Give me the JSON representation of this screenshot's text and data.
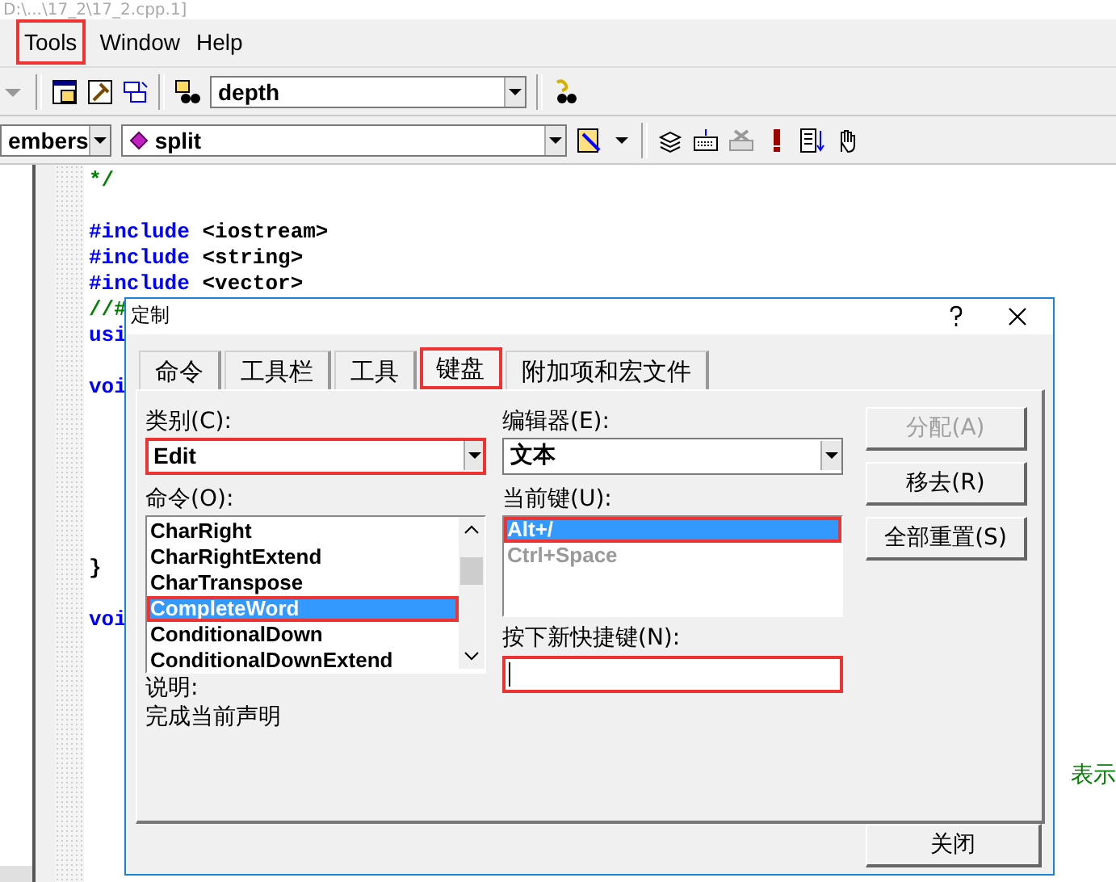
{
  "window": {
    "title": "D:\\...\\17_2\\17_2.cpp.1]"
  },
  "menu": [
    {
      "label": "Tools",
      "highlighted": true
    },
    {
      "label": "Window",
      "highlighted": false
    },
    {
      "label": "Help",
      "highlighted": false
    }
  ],
  "toolbar_1": {
    "find_combo": {
      "value": "depth"
    }
  },
  "toolbar_2": {
    "class_combo": {
      "value": "embers"
    },
    "member_combo": {
      "value": "split"
    }
  },
  "code_lines": [
    {
      "kind": "comment",
      "text": "*/"
    },
    {
      "kind": "blank"
    },
    {
      "kind": "directive",
      "keyword": "#include",
      "text": "<iostream>"
    },
    {
      "kind": "directive",
      "keyword": "#include",
      "text": "<string>"
    },
    {
      "kind": "directive",
      "keyword": "#include",
      "text": "<vector>"
    },
    {
      "kind": "comment",
      "text": "//#"
    },
    {
      "kind": "keyword",
      "text": "usi"
    },
    {
      "kind": "blank"
    },
    {
      "kind": "keyword",
      "text": "voi"
    },
    {
      "kind": "blank"
    },
    {
      "kind": "blank"
    },
    {
      "kind": "blank"
    },
    {
      "kind": "blank"
    },
    {
      "kind": "blank"
    },
    {
      "kind": "blank"
    },
    {
      "kind": "plain",
      "text": "}"
    },
    {
      "kind": "blank"
    },
    {
      "kind": "keyword",
      "text": "voi"
    },
    {
      "kind": "blank"
    },
    {
      "kind": "blank"
    },
    {
      "kind": "blank"
    },
    {
      "kind": "blank"
    },
    {
      "kind": "blank"
    },
    {
      "kind": "comment_tail",
      "text": "表示"
    }
  ],
  "dialog": {
    "title": "定制",
    "tabs": [
      {
        "label": "命令",
        "selected": false,
        "highlighted": false
      },
      {
        "label": "工具栏",
        "selected": false,
        "highlighted": false
      },
      {
        "label": "工具",
        "selected": false,
        "highlighted": false
      },
      {
        "label": "键盘",
        "selected": true,
        "highlighted": true
      },
      {
        "label": "附加项和宏文件",
        "selected": false,
        "highlighted": false
      }
    ],
    "category": {
      "label": "类别(C):",
      "value": "Edit",
      "highlighted": true
    },
    "editor": {
      "label": "编辑器(E):",
      "value": "文本"
    },
    "commands": {
      "label": "命令(O):",
      "items": [
        {
          "label": "CharRight",
          "selected": false,
          "highlighted": false
        },
        {
          "label": "CharRightExtend",
          "selected": false,
          "highlighted": false
        },
        {
          "label": "CharTranspose",
          "selected": false,
          "highlighted": false
        },
        {
          "label": "CompleteWord",
          "selected": true,
          "highlighted": true
        },
        {
          "label": "ConditionalDown",
          "selected": false,
          "highlighted": false
        },
        {
          "label": "ConditionalDownExtend",
          "selected": false,
          "highlighted": false
        }
      ]
    },
    "current_keys": {
      "label": "当前键(U):",
      "items": [
        {
          "label": "Alt+/",
          "selected": true,
          "disabled": false,
          "highlighted": true
        },
        {
          "label": "Ctrl+Space",
          "selected": false,
          "disabled": true,
          "highlighted": false
        }
      ]
    },
    "new_shortcut": {
      "label": "按下新快捷键(N):",
      "highlighted": true
    },
    "description": {
      "label": "说明:",
      "text": "完成当前声明"
    },
    "buttons": [
      {
        "label": "分配(A)",
        "disabled": true
      },
      {
        "label": "移去(R)",
        "disabled": false
      },
      {
        "label": "全部重置(S)",
        "disabled": false
      }
    ],
    "close_button": {
      "label": "关闭"
    }
  }
}
